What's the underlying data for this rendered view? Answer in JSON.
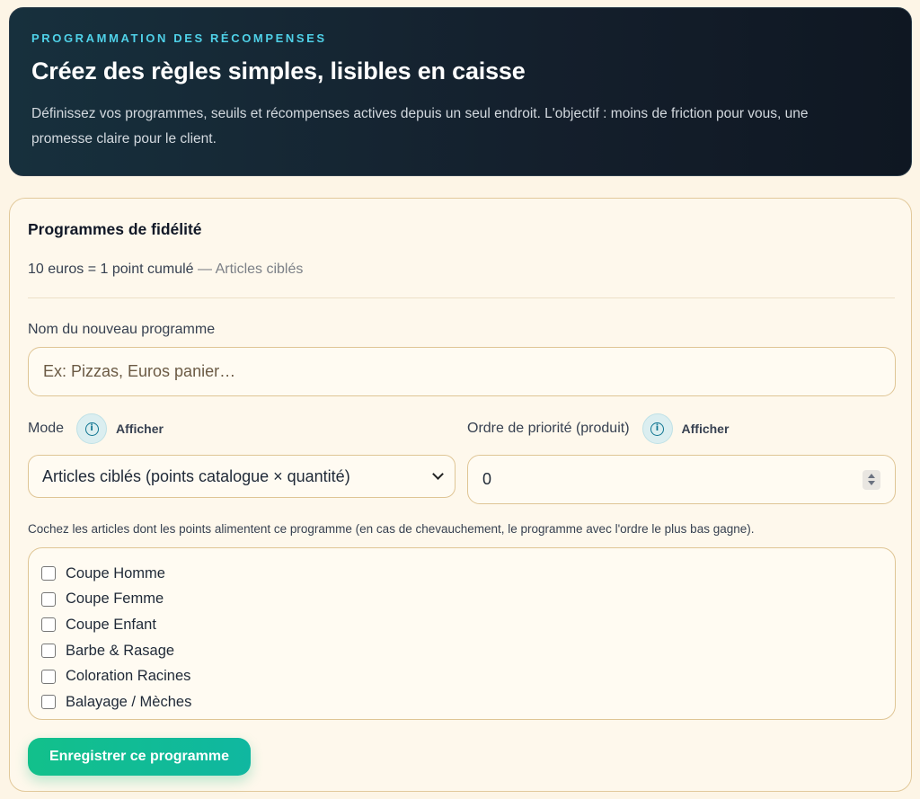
{
  "hero": {
    "eyebrow": "PROGRAMMATION DES RÉCOMPENSES",
    "title": "Créez des règles simples, lisibles en caisse",
    "description": "Définissez vos programmes, seuils et récompenses actives depuis un seul endroit. L'objectif : moins de friction pour vous, une promesse claire pour le client."
  },
  "card": {
    "title": "Programmes de fidélité",
    "summary_main": "10 euros = 1 point cumulé",
    "summary_muted": " — Articles ciblés"
  },
  "form": {
    "name_label": "Nom du nouveau programme",
    "name_placeholder": "Ex: Pizzas, Euros panier…",
    "name_value": "",
    "mode_label": "Mode",
    "mode_show": "Afficher",
    "mode_value": "Articles ciblés (points catalogue × quantité)",
    "priority_label": "Ordre de priorité (produit)",
    "priority_show": "Afficher",
    "priority_value": "0",
    "hint": "Cochez les articles dont les points alimentent ce programme (en cas de chevauchement, le programme avec l'ordre le plus bas gagne).",
    "items": [
      {
        "label": "Coupe Homme",
        "checked": false
      },
      {
        "label": "Coupe Femme",
        "checked": false
      },
      {
        "label": "Coupe Enfant",
        "checked": false
      },
      {
        "label": "Barbe & Rasage",
        "checked": false
      },
      {
        "label": "Coloration Racines",
        "checked": false
      },
      {
        "label": "Balayage / Mèches",
        "checked": false
      }
    ],
    "save_label": "Enregistrer ce programme"
  },
  "icons": {
    "info": "info-circle-icon",
    "dropdown": "chevron-down-icon",
    "spinner": "number-spinner-icon"
  },
  "colors": {
    "accent": "#4fd1e8",
    "primary_button": "#12c08b",
    "hero_bg": "#141f2c",
    "page_bg": "#fdf5e6"
  }
}
